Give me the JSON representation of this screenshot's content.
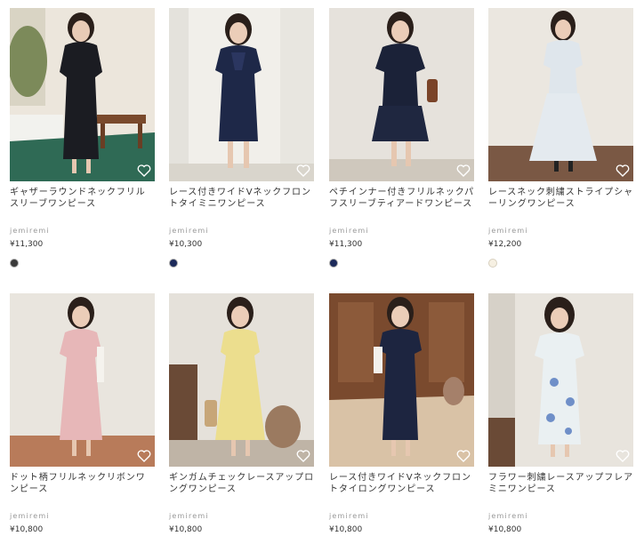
{
  "products": [
    {
      "name": "ギャザーラウンドネックフリルスリーブワンピース",
      "brand": "jemiremi",
      "price": "¥11,300",
      "swatch_color": "#3a3a3a"
    },
    {
      "name": "レース付きワイドVネックフロントタイミニワンピース",
      "brand": "jemiremi",
      "price": "¥10,300",
      "swatch_color": "#1c2a5a"
    },
    {
      "name": "ペチインナー付きフリルネックパフスリーブティアードワンピース",
      "brand": "jemiremi",
      "price": "¥11,300",
      "swatch_color": "#1c2a5a"
    },
    {
      "name": "レースネック刺繍ストライプシャーリングワンピース",
      "brand": "jemiremi",
      "price": "¥12,200",
      "swatch_color": "#f6f0e2"
    },
    {
      "name": "ドット柄フリルネックリボンワンピース",
      "brand": "jemiremi",
      "price": "¥10,800"
    },
    {
      "name": "ギンガムチェックレースアップロングワンピース",
      "brand": "jemiremi",
      "price": "¥10,800"
    },
    {
      "name": "レース付きワイドVネックフロントタイロングワンピース",
      "brand": "jemiremi",
      "price": "¥10,800"
    },
    {
      "name": "フラワー刺繍レースアップフレアミニワンピース",
      "brand": "jemiremi",
      "price": "¥10,800"
    }
  ]
}
